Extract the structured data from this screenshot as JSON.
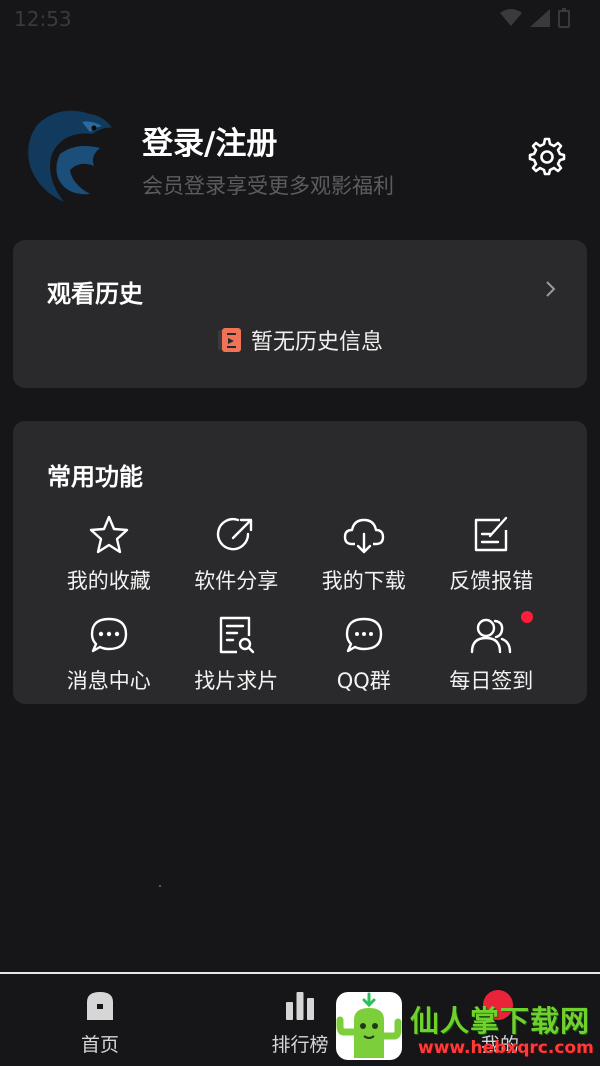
{
  "status": {
    "time": "12:53"
  },
  "profile": {
    "title": "登录/注册",
    "subtitle": "会员登录享受更多观影福利"
  },
  "history": {
    "title": "观看历史",
    "empty_text": "暂无历史信息"
  },
  "functions": {
    "title": "常用功能",
    "items": [
      {
        "label": "我的收藏",
        "icon": "star-icon"
      },
      {
        "label": "软件分享",
        "icon": "share-icon"
      },
      {
        "label": "我的下载",
        "icon": "cloud-download-icon"
      },
      {
        "label": "反馈报错",
        "icon": "feedback-icon"
      },
      {
        "label": "消息中心",
        "icon": "message-icon"
      },
      {
        "label": "找片求片",
        "icon": "search-document-icon"
      },
      {
        "label": "QQ群",
        "icon": "chat-group-icon"
      },
      {
        "label": "每日签到",
        "icon": "users-icon",
        "badge": true
      }
    ]
  },
  "tabbar": {
    "home": "首页",
    "rank": "排行榜",
    "mine": "我的"
  },
  "watermark": {
    "title": "仙人掌下载网",
    "url": "www.hebxqrc.com"
  },
  "colors": {
    "background": "#161618",
    "card": "#2a2a2d",
    "badge": "#ff1e3a",
    "subtitle": "#5c5c60"
  }
}
